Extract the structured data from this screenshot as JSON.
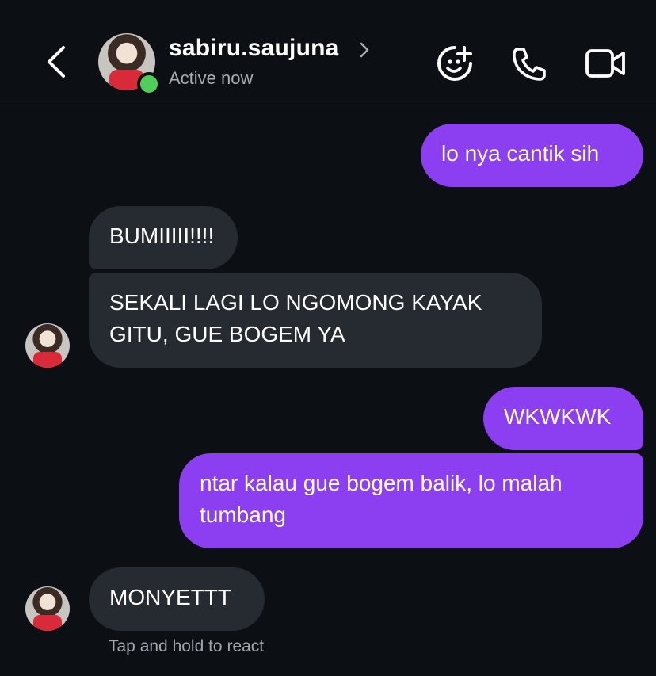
{
  "header": {
    "username": "sabiru.saujuna",
    "status": "Active now",
    "icons": [
      "back-chevron-icon",
      "sticker-add-icon",
      "phone-icon",
      "video-camera-icon"
    ]
  },
  "messages": [
    {
      "from": "me",
      "text": "lo nya cantik sih"
    },
    {
      "from": "them",
      "text": "BUMIIIII!!!!"
    },
    {
      "from": "them",
      "text": "SEKALI LAGI LO NGOMONG KAYAK GITU, GUE BOGEM YA"
    },
    {
      "from": "me",
      "text": "WKWKWK"
    },
    {
      "from": "me",
      "text": "ntar kalau gue bogem balik, lo malah tumbang"
    },
    {
      "from": "them",
      "text": "MONYETTT"
    }
  ],
  "hint": "Tap and hold to react",
  "colors": {
    "me_bubble": "#8b3ff0",
    "them_bubble": "#262a31",
    "online": "#4fce5a",
    "background": "#0c0f14"
  }
}
